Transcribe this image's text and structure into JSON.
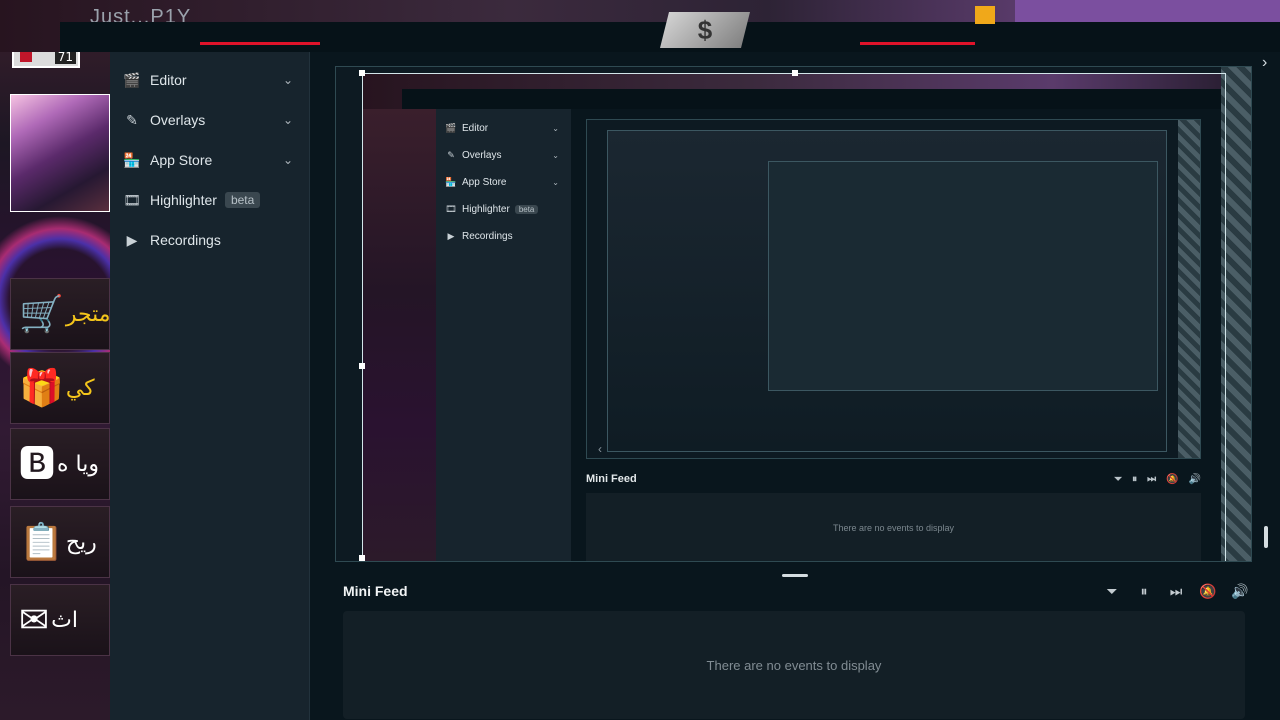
{
  "overlay": {
    "username": "Just...P1Y",
    "level": "71",
    "tiles": [
      {
        "icon": "🛒",
        "text": "متجر",
        "color": "yellow"
      },
      {
        "icon": "🎁",
        "text": "كي",
        "color": "yellow"
      },
      {
        "icon": "🅱",
        "text": "ويا ه",
        "color": "white"
      },
      {
        "icon": "📋",
        "text": "ريح",
        "color": "white"
      },
      {
        "icon": "✉",
        "text": "اث",
        "color": "white"
      }
    ]
  },
  "sidebar": {
    "items": [
      {
        "label": "Editor",
        "icon": "editor-icon",
        "glyph": "🎬",
        "expandable": true
      },
      {
        "label": "Overlays",
        "icon": "overlays-icon",
        "glyph": "✎",
        "expandable": true
      },
      {
        "label": "App Store",
        "icon": "app-store-icon",
        "glyph": "🏪",
        "expandable": true
      },
      {
        "label": "Highlighter",
        "icon": "highlighter-icon",
        "glyph": "🎞",
        "badge": "beta"
      },
      {
        "label": "Recordings",
        "icon": "recordings-icon",
        "glyph": "▶"
      }
    ]
  },
  "mini_feed": {
    "title": "Mini Feed",
    "empty_text": "There are no events to display",
    "tools": [
      {
        "name": "filter-icon",
        "glyph": "⏷"
      },
      {
        "name": "pause-icon",
        "glyph": "⏸"
      },
      {
        "name": "skip-icon",
        "glyph": "⏭"
      },
      {
        "name": "mute-notifications-icon",
        "glyph": "🔕"
      },
      {
        "name": "volume-icon",
        "glyph": "🔊"
      }
    ]
  },
  "nested_studio": {
    "sidebar": [
      {
        "label": "Editor",
        "glyph": "🎬",
        "expandable": true
      },
      {
        "label": "Overlays",
        "glyph": "✎",
        "expandable": true
      },
      {
        "label": "App Store",
        "glyph": "🏪",
        "expandable": true
      },
      {
        "label": "Highlighter",
        "glyph": "🎞",
        "badge": "beta"
      },
      {
        "label": "Recordings",
        "glyph": "▶"
      }
    ],
    "feed_title": "Mini Feed",
    "feed_empty": "There are no events to display"
  },
  "colors": {
    "accent_red": "#e0132a",
    "panel_bg": "#17242d",
    "main_bg": "#09161d",
    "feed_bg": "#131f26"
  }
}
